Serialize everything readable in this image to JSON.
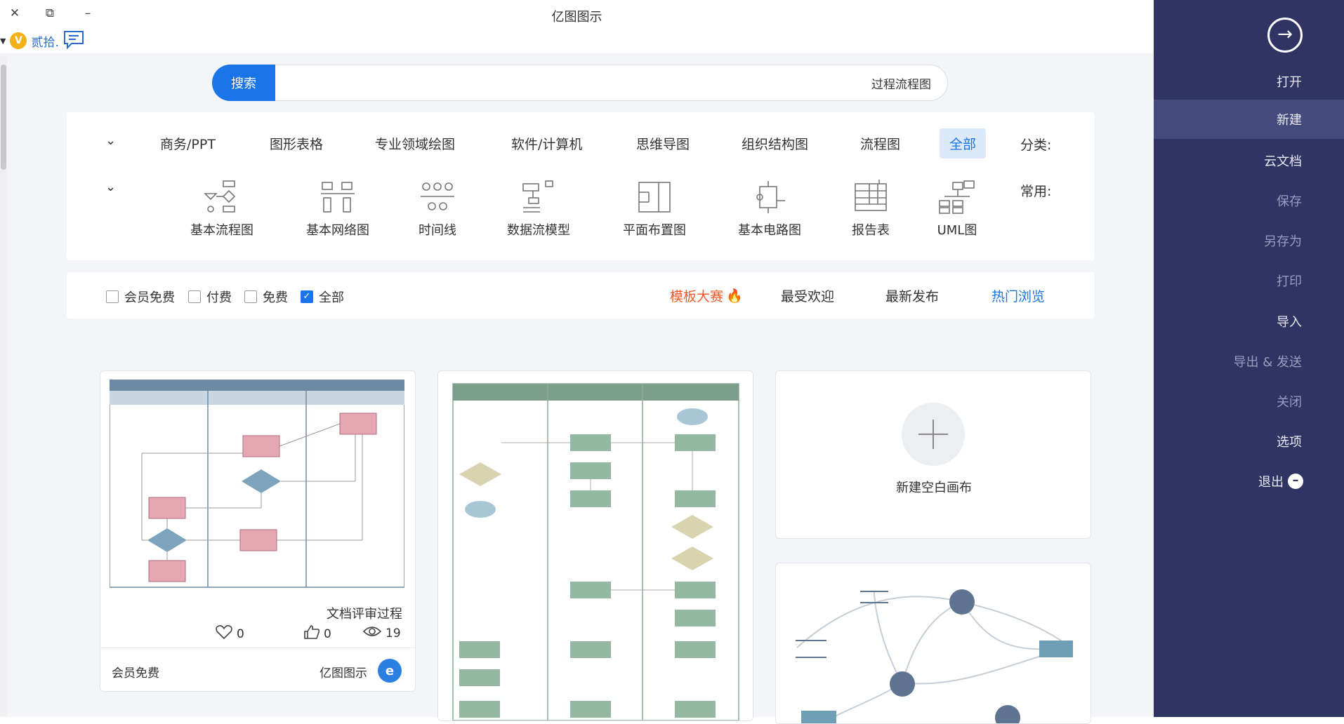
{
  "app": {
    "title": "亿图图示",
    "user": "贰拾.",
    "window_controls": {
      "close": "✕",
      "restore": "⧉",
      "minimize": "–"
    }
  },
  "search": {
    "button": "搜索",
    "value": "过程流程图"
  },
  "categories": {
    "label": "分类:",
    "items": [
      "全部",
      "流程图",
      "组织结构图",
      "思维导图",
      "软件/计算机",
      "专业领域绘图",
      "图形表格",
      "商务/PPT"
    ],
    "active": "全部"
  },
  "common": {
    "label": "常用:",
    "items": [
      "UML图",
      "报告表",
      "基本电路图",
      "平面布置图",
      "数据流模型",
      "时间线",
      "基本网络图",
      "基本流程图"
    ]
  },
  "sort": {
    "tabs": [
      "热门浏览",
      "最新发布",
      "最受欢迎",
      "模板大赛"
    ],
    "active": "热门浏览",
    "filters": [
      {
        "label": "全部",
        "checked": true
      },
      {
        "label": "免费",
        "checked": false
      },
      {
        "label": "付费",
        "checked": false
      },
      {
        "label": "会员免费",
        "checked": false
      }
    ]
  },
  "cards": {
    "new_blank": "新建空白画布",
    "template": {
      "title": "文档评审过程",
      "views": "19",
      "likes": "0",
      "favorites": "0",
      "author": "亿图图示",
      "price": "会员免费"
    }
  },
  "sidebar": {
    "items": [
      "打开",
      "新建",
      "云文档",
      "保存",
      "另存为",
      "打印",
      "导入",
      "导出 & 发送",
      "关闭",
      "选项",
      "退出"
    ],
    "active": "新建"
  },
  "colors": {
    "sidebar_bg": "#2f3463",
    "sidebar_active": "#454b7c",
    "accent": "#1a75e8",
    "contest": "#f05a28",
    "vip": "#f3b21c"
  }
}
